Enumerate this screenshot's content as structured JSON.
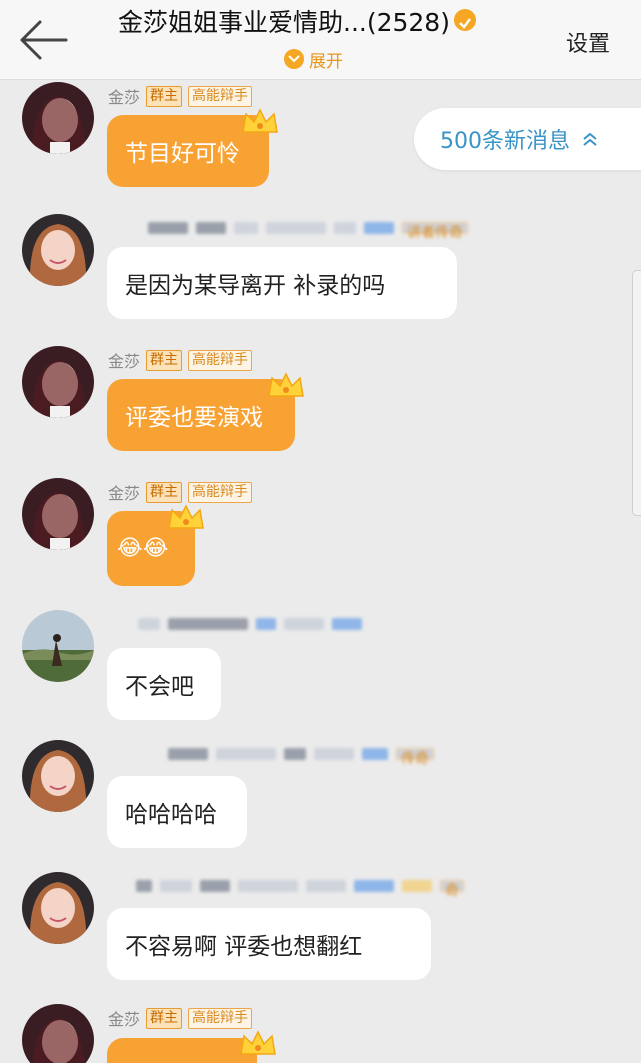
{
  "header": {
    "back_icon": "arrow-left-icon",
    "title": "金莎姐姐事业爱情助...(2528)",
    "expand_label": "展开",
    "settings_label": "设置",
    "accent": "#f5a623"
  },
  "new_messages": {
    "label": "500条新消息"
  },
  "messages": [
    {
      "nick": "金莎",
      "tags": [
        "群主",
        "高能辩手"
      ],
      "text": "节目好可怜",
      "bubble": "orange",
      "crown": true
    },
    {
      "nick": "",
      "tags": [
        "讲者传奇"
      ],
      "text": "是因为某导离开   补录的吗",
      "bubble": "white",
      "crown": false
    },
    {
      "nick": "金莎",
      "tags": [
        "群主",
        "高能辩手"
      ],
      "text": "评委也要演戏",
      "bubble": "orange",
      "crown": true
    },
    {
      "nick": "金莎",
      "tags": [
        "群主",
        "高能辩手"
      ],
      "text": "😂😂",
      "bubble": "orange",
      "crown": true
    },
    {
      "nick": "",
      "tags": [],
      "text": "不会吧",
      "bubble": "white",
      "crown": false
    },
    {
      "nick": "",
      "tags": [
        "传奇"
      ],
      "text": "哈哈哈哈",
      "bubble": "white",
      "crown": false
    },
    {
      "nick": "",
      "tags": [
        "奇"
      ],
      "text": "不容易啊   评委也想翻红",
      "bubble": "white",
      "crown": false
    },
    {
      "nick": "金莎",
      "tags": [
        "群主",
        "高能辩手"
      ],
      "text": "",
      "bubble": "orange",
      "crown": true
    }
  ],
  "colors": {
    "bubble_orange": "#f9a234",
    "link_blue": "#3a93c7",
    "background": "#ebebeb"
  }
}
